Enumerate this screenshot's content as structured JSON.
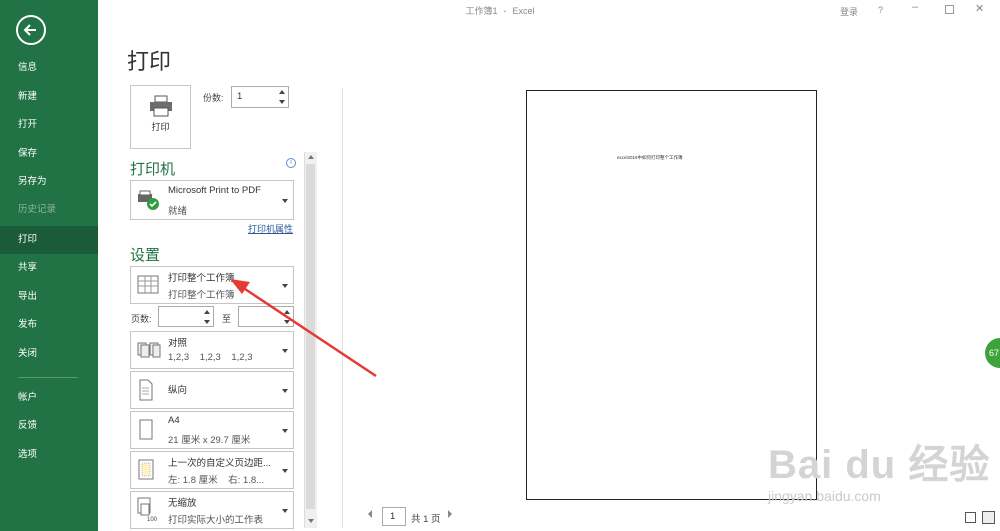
{
  "window": {
    "title_doc": "工作簿1",
    "title_sep": "-",
    "title_app": "Excel",
    "login": "登录",
    "help": "?",
    "minimize": "–",
    "close": "✕"
  },
  "sidebar": {
    "items": [
      {
        "label": "信息",
        "state": "normal"
      },
      {
        "label": "新建",
        "state": "normal"
      },
      {
        "label": "打开",
        "state": "normal"
      },
      {
        "label": "保存",
        "state": "normal"
      },
      {
        "label": "另存为",
        "state": "normal"
      },
      {
        "label": "历史记录",
        "state": "disabled"
      },
      {
        "label": "打印",
        "state": "active"
      },
      {
        "label": "共享",
        "state": "normal"
      },
      {
        "label": "导出",
        "state": "normal"
      },
      {
        "label": "发布",
        "state": "normal"
      },
      {
        "label": "关闭",
        "state": "normal"
      },
      {
        "label": "帐户",
        "state": "normal"
      },
      {
        "label": "反馈",
        "state": "normal"
      },
      {
        "label": "选项",
        "state": "normal"
      }
    ]
  },
  "print": {
    "page_title": "打印",
    "button_label": "打印",
    "copies_label": "份数:",
    "copies_value": "1"
  },
  "printer": {
    "heading": "打印机",
    "info_icon": "i",
    "name": "Microsoft Print to PDF",
    "status": "就绪",
    "properties_link": "打印机属性"
  },
  "settings": {
    "heading": "设置",
    "scope": {
      "line1": "打印整个工作簿",
      "line2": "打印整个工作簿"
    },
    "pages_label": "页数:",
    "to_label": "至",
    "collate": {
      "line1": "对照",
      "line2": "1,2,3    1,2,3    1,2,3"
    },
    "orientation": {
      "line1": "纵向"
    },
    "paper": {
      "line1": "A4",
      "line2": "21 厘米 x 29.7 厘米"
    },
    "margins": {
      "line1": "上一次的自定义页边距...",
      "line2": "左: 1.8 厘米    右: 1.8..."
    },
    "scaling": {
      "line1": "无缩放",
      "line2": "打印实际大小的工作表"
    }
  },
  "preview": {
    "page_text": "excel2016中如何打印整个工作簿",
    "current_page": "1",
    "total_pages": "共 1 页"
  },
  "overlay": {
    "badge": "67",
    "watermark_logo": "Bai du 经验",
    "watermark_url": "jingyan.baidu.com"
  },
  "colors": {
    "accent": "#217346",
    "active_nav": "#1a5c38",
    "arrow": "#e53935"
  }
}
